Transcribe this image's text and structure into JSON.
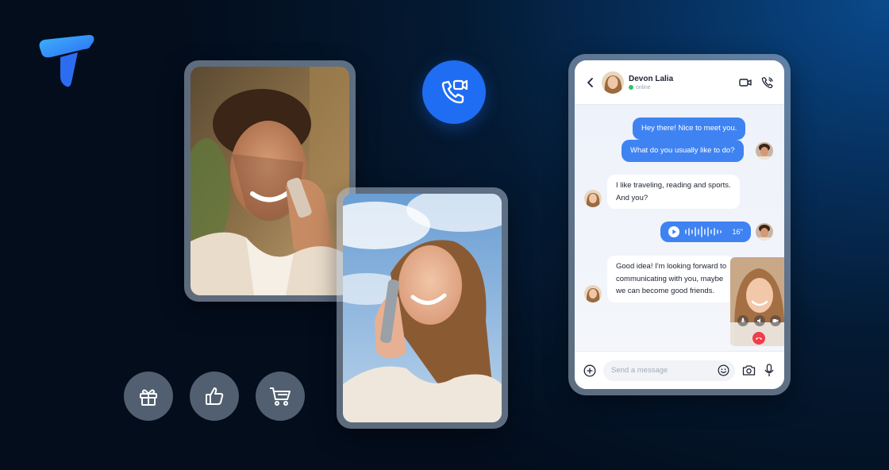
{
  "brand": {
    "accent": "#1f6df2",
    "bubble_out": "#3f83f3",
    "bubble_in": "#ffffff",
    "end_call": "#ef3e4a",
    "online": "#2bc46b"
  },
  "icons": {
    "logo": "brand-logo-icon",
    "call_badge": "video-call-icon",
    "actions": [
      "gift-icon",
      "thumbs-up-icon",
      "shopping-cart-icon"
    ]
  },
  "chat": {
    "contact_name": "Devon Lalia",
    "status": "online",
    "messages": [
      {
        "side": "out",
        "text": "Hey there! Nice to meet you."
      },
      {
        "side": "out",
        "text": "What do you usually like to do?"
      },
      {
        "side": "in",
        "lines": [
          "I like traveling, reading and sports.",
          "And you?"
        ]
      },
      {
        "side": "out",
        "type": "voice",
        "duration": "16''"
      },
      {
        "side": "in",
        "lines": [
          "Good idea! I'm looking forward to",
          "communicating with you, maybe",
          "we can become good friends."
        ]
      }
    ],
    "input_placeholder": "Send a message"
  }
}
